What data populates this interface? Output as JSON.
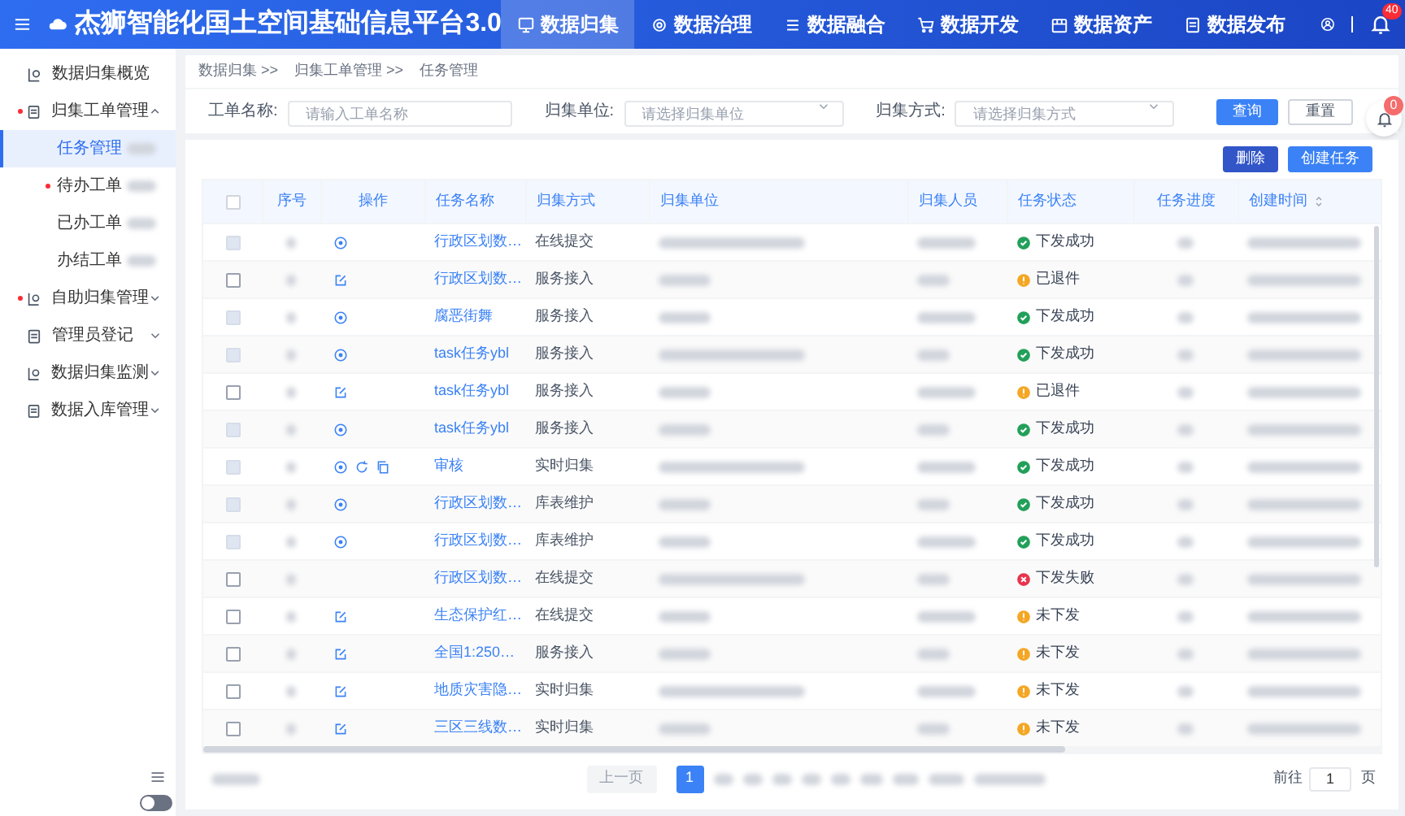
{
  "header": {
    "title": "杰狮智能化国土空间基础信息平台3.0",
    "nav": [
      {
        "label": "数据归集",
        "selected": true
      },
      {
        "label": "数据治理",
        "selected": false
      },
      {
        "label": "数据融合",
        "selected": false
      },
      {
        "label": "数据开发",
        "selected": false
      },
      {
        "label": "数据资产",
        "selected": false
      },
      {
        "label": "数据发布",
        "selected": false
      }
    ],
    "notification_count": "40"
  },
  "sidebar": {
    "items": [
      {
        "label": "数据归集概览",
        "dot": false
      },
      {
        "label": "归集工单管理",
        "dot": true,
        "expanded": true,
        "children": [
          {
            "label": "任务管理",
            "selected": true,
            "dot": false
          },
          {
            "label": "待办工单",
            "selected": false,
            "dot": true
          },
          {
            "label": "已办工单",
            "selected": false,
            "dot": false
          },
          {
            "label": "办结工单",
            "selected": false,
            "dot": false
          }
        ]
      },
      {
        "label": "自助归集管理",
        "dot": true,
        "expanded": false
      },
      {
        "label": "管理员登记",
        "dot": false,
        "expanded": false
      },
      {
        "label": "数据归集监测",
        "dot": false,
        "expanded": false
      },
      {
        "label": "数据入库管理",
        "dot": false,
        "expanded": false
      }
    ],
    "toggle_on": false
  },
  "breadcrumb": [
    "数据归集 >>",
    "归集工单管理 >>",
    "任务管理"
  ],
  "filters": [
    {
      "label": "工单名称:",
      "placeholder": "请输入工单名称",
      "kind": "input"
    },
    {
      "label": "归集单位:",
      "placeholder": "请选择归集单位",
      "kind": "select"
    },
    {
      "label": "归集方式:",
      "placeholder": "请选择归集方式",
      "kind": "select"
    }
  ],
  "filter_buttons": [
    {
      "label": "查询",
      "primary": true
    },
    {
      "label": "重置",
      "primary": false
    }
  ],
  "float_badge": "0",
  "actions": [
    "删除",
    "创建任务"
  ],
  "table": {
    "select_all": false,
    "columns": [
      "序号",
      "操作",
      "任务名称",
      "归集方式",
      "归集单位",
      "归集人员",
      "任务状态",
      "任务进度",
      "创建时间"
    ],
    "rows": [
      {
        "ops": [
          {
            "kind": "view"
          }
        ],
        "name": "行政区划数…",
        "method": "在线提交",
        "status": {
          "label": "下发成功",
          "kind": "success"
        },
        "disabled": true
      },
      {
        "ops": [
          {
            "kind": "edit"
          }
        ],
        "name": "行政区划数…",
        "method": "服务接入",
        "status": {
          "label": "已退件",
          "kind": "warning"
        },
        "disabled": false
      },
      {
        "ops": [
          {
            "kind": "view"
          }
        ],
        "name": "腐恶街舞",
        "method": "服务接入",
        "status": {
          "label": "下发成功",
          "kind": "success"
        },
        "disabled": true
      },
      {
        "ops": [
          {
            "kind": "view"
          }
        ],
        "name": "task任务ybl",
        "method": "服务接入",
        "status": {
          "label": "下发成功",
          "kind": "success"
        },
        "disabled": true
      },
      {
        "ops": [
          {
            "kind": "edit"
          }
        ],
        "name": "task任务ybl",
        "method": "服务接入",
        "status": {
          "label": "已退件",
          "kind": "warning"
        },
        "disabled": false
      },
      {
        "ops": [
          {
            "kind": "view"
          }
        ],
        "name": "task任务ybl",
        "method": "服务接入",
        "status": {
          "label": "下发成功",
          "kind": "success"
        },
        "disabled": true
      },
      {
        "ops": [
          {
            "kind": "view"
          },
          {
            "kind": "refresh"
          },
          {
            "kind": "copy"
          }
        ],
        "name": "审核",
        "method": "实时归集",
        "status": {
          "label": "下发成功",
          "kind": "success"
        },
        "disabled": true
      },
      {
        "ops": [
          {
            "kind": "view"
          }
        ],
        "name": "行政区划数…",
        "method": "库表维护",
        "status": {
          "label": "下发成功",
          "kind": "success"
        },
        "disabled": true
      },
      {
        "ops": [
          {
            "kind": "view"
          }
        ],
        "name": "行政区划数…",
        "method": "库表维护",
        "status": {
          "label": "下发成功",
          "kind": "success"
        },
        "disabled": true
      },
      {
        "ops": [],
        "name": "行政区划数…",
        "method": "在线提交",
        "status": {
          "label": "下发失败",
          "kind": "error"
        },
        "disabled": false
      },
      {
        "ops": [
          {
            "kind": "edit"
          }
        ],
        "name": "生态保护红…",
        "method": "在线提交",
        "status": {
          "label": "未下发",
          "kind": "warning"
        },
        "disabled": false
      },
      {
        "ops": [
          {
            "kind": "edit"
          }
        ],
        "name": "全国1:250…",
        "method": "服务接入",
        "status": {
          "label": "未下发",
          "kind": "warning"
        },
        "disabled": false
      },
      {
        "ops": [
          {
            "kind": "edit"
          }
        ],
        "name": "地质灾害隐…",
        "method": "实时归集",
        "status": {
          "label": "未下发",
          "kind": "warning"
        },
        "disabled": false
      },
      {
        "ops": [
          {
            "kind": "edit"
          }
        ],
        "name": "三区三线数…",
        "method": "实时归集",
        "status": {
          "label": "未下发",
          "kind": "warning"
        },
        "disabled": false
      }
    ]
  },
  "pagination": {
    "prev": "上一页",
    "prev_disabled": true,
    "current_page": "1",
    "goto_label": "前往",
    "goto_value": "1",
    "goto_unit": "页"
  }
}
